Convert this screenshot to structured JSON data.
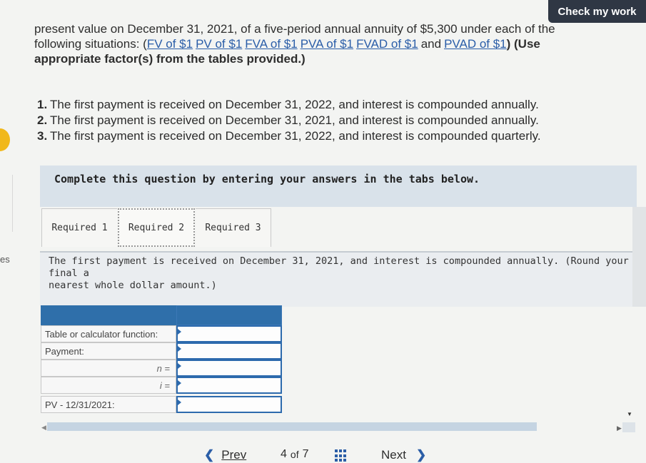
{
  "header": {
    "check_label": "Check my work"
  },
  "intro": {
    "line1": "present value on December 31, 2021, of a five-period annual annuity of $5,300 under each of the",
    "line2_prefix": "following situations: (",
    "links": [
      "FV of $1",
      "PV of $1",
      "FVA of $1",
      "PVA of $1",
      "FVAD of $1",
      "PVAD of $1"
    ],
    "conj": "and",
    "line2_suffix": ") (Use",
    "line3": "appropriate factor(s) from the tables provided.)"
  },
  "requirements": [
    {
      "num": "1.",
      "text": "The first payment is received on December 31, 2022, and interest is compounded annually."
    },
    {
      "num": "2.",
      "text": "The first payment is received on December 31, 2021, and interest is compounded annually."
    },
    {
      "num": "3.",
      "text": "The first payment is received on December 31, 2022, and interest is compounded quarterly."
    }
  ],
  "instruction": "Complete this question by entering your answers in the tabs below.",
  "tabs": [
    {
      "label": "Required 1"
    },
    {
      "label": "Required 2",
      "active": true
    },
    {
      "label": "Required 3"
    }
  ],
  "panel": {
    "line1": "The first payment is received on December 31, 2021, and interest is compounded annually. (Round your final a",
    "line2": "nearest whole dollar amount.)"
  },
  "table": {
    "rows": [
      {
        "label": "Table or calculator function:"
      },
      {
        "label": "Payment:"
      },
      {
        "label": "n ="
      },
      {
        "label": "i ="
      },
      {
        "label": "PV - 12/31/2021:"
      }
    ]
  },
  "sidebar_fragment": "es",
  "nav": {
    "prev_label": "Prev",
    "current_page": "4",
    "of_label": "of",
    "total_pages": "7",
    "next_label": "Next"
  },
  "colors": {
    "accent": "#2f6faa",
    "check_button": "#2f3744",
    "link": "#2a5da8",
    "dot": "#f1b81a"
  }
}
